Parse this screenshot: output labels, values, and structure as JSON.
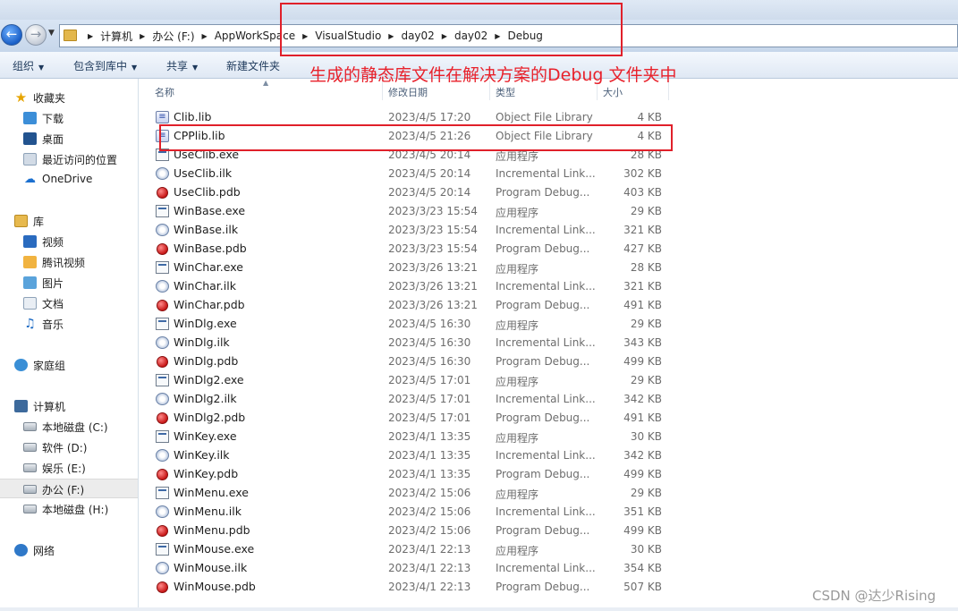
{
  "address_bar": {
    "crumbs": [
      "计算机",
      "办公 (F:)",
      "AppWorkSpace",
      "VisualStudio",
      "day02",
      "day02",
      "Debug"
    ]
  },
  "toolbar": {
    "organize": "组织",
    "include_in_library": "包含到库中",
    "share": "共享",
    "new_folder": "新建文件夹"
  },
  "annotation": "生成的静态库文件在解决方案的Debug 文件夹中",
  "sidebar": {
    "favorites": {
      "label": "收藏夹",
      "icon": "star-icon"
    },
    "favorites_items": [
      {
        "label": "下载",
        "icon": "downloads-icon"
      },
      {
        "label": "桌面",
        "icon": "desktop-icon"
      },
      {
        "label": "最近访问的位置",
        "icon": "recent-places-icon"
      },
      {
        "label": "OneDrive",
        "icon": "onedrive-icon"
      }
    ],
    "libraries": {
      "label": "库",
      "icon": "library-icon"
    },
    "libraries_items": [
      {
        "label": "视频",
        "icon": "videos-icon"
      },
      {
        "label": "腾讯视频",
        "icon": "tencent-video-icon"
      },
      {
        "label": "图片",
        "icon": "pictures-icon"
      },
      {
        "label": "文档",
        "icon": "documents-icon"
      },
      {
        "label": "音乐",
        "icon": "music-icon"
      }
    ],
    "homegroup": {
      "label": "家庭组",
      "icon": "homegroup-icon"
    },
    "computer": {
      "label": "计算机",
      "icon": "computer-icon"
    },
    "computer_items": [
      {
        "label": "本地磁盘 (C:)",
        "icon": "drive-icon",
        "selected": false
      },
      {
        "label": "软件 (D:)",
        "icon": "drive-icon",
        "selected": false
      },
      {
        "label": "娱乐 (E:)",
        "icon": "drive-icon",
        "selected": false
      },
      {
        "label": "办公 (F:)",
        "icon": "drive-icon",
        "selected": true
      },
      {
        "label": "本地磁盘 (H:)",
        "icon": "drive-icon",
        "selected": false
      }
    ],
    "network": {
      "label": "网络",
      "icon": "network-icon"
    }
  },
  "columns": {
    "name": "名称",
    "date_modified": "修改日期",
    "type": "类型",
    "size": "大小"
  },
  "files": [
    {
      "name": "Clib.lib",
      "date": "2023/4/5 17:20",
      "type": "Object File Library",
      "size": "4 KB",
      "kind": "lib"
    },
    {
      "name": "CPPlib.lib",
      "date": "2023/4/5 21:26",
      "type": "Object File Library",
      "size": "4 KB",
      "kind": "lib"
    },
    {
      "name": "UseClib.exe",
      "date": "2023/4/5 20:14",
      "type": "应用程序",
      "size": "28 KB",
      "kind": "exe"
    },
    {
      "name": "UseClib.ilk",
      "date": "2023/4/5 20:14",
      "type": "Incremental Link...",
      "size": "302 KB",
      "kind": "ilk"
    },
    {
      "name": "UseClib.pdb",
      "date": "2023/4/5 20:14",
      "type": "Program Debug...",
      "size": "403 KB",
      "kind": "pdb"
    },
    {
      "name": "WinBase.exe",
      "date": "2023/3/23 15:54",
      "type": "应用程序",
      "size": "29 KB",
      "kind": "exe"
    },
    {
      "name": "WinBase.ilk",
      "date": "2023/3/23 15:54",
      "type": "Incremental Link...",
      "size": "321 KB",
      "kind": "ilk"
    },
    {
      "name": "WinBase.pdb",
      "date": "2023/3/23 15:54",
      "type": "Program Debug...",
      "size": "427 KB",
      "kind": "pdb"
    },
    {
      "name": "WinChar.exe",
      "date": "2023/3/26 13:21",
      "type": "应用程序",
      "size": "28 KB",
      "kind": "exe"
    },
    {
      "name": "WinChar.ilk",
      "date": "2023/3/26 13:21",
      "type": "Incremental Link...",
      "size": "321 KB",
      "kind": "ilk"
    },
    {
      "name": "WinChar.pdb",
      "date": "2023/3/26 13:21",
      "type": "Program Debug...",
      "size": "491 KB",
      "kind": "pdb"
    },
    {
      "name": "WinDlg.exe",
      "date": "2023/4/5 16:30",
      "type": "应用程序",
      "size": "29 KB",
      "kind": "exe"
    },
    {
      "name": "WinDlg.ilk",
      "date": "2023/4/5 16:30",
      "type": "Incremental Link...",
      "size": "343 KB",
      "kind": "ilk"
    },
    {
      "name": "WinDlg.pdb",
      "date": "2023/4/5 16:30",
      "type": "Program Debug...",
      "size": "499 KB",
      "kind": "pdb"
    },
    {
      "name": "WinDlg2.exe",
      "date": "2023/4/5 17:01",
      "type": "应用程序",
      "size": "29 KB",
      "kind": "exe"
    },
    {
      "name": "WinDlg2.ilk",
      "date": "2023/4/5 17:01",
      "type": "Incremental Link...",
      "size": "342 KB",
      "kind": "ilk"
    },
    {
      "name": "WinDlg2.pdb",
      "date": "2023/4/5 17:01",
      "type": "Program Debug...",
      "size": "491 KB",
      "kind": "pdb"
    },
    {
      "name": "WinKey.exe",
      "date": "2023/4/1 13:35",
      "type": "应用程序",
      "size": "30 KB",
      "kind": "exe"
    },
    {
      "name": "WinKey.ilk",
      "date": "2023/4/1 13:35",
      "type": "Incremental Link...",
      "size": "342 KB",
      "kind": "ilk"
    },
    {
      "name": "WinKey.pdb",
      "date": "2023/4/1 13:35",
      "type": "Program Debug...",
      "size": "499 KB",
      "kind": "pdb"
    },
    {
      "name": "WinMenu.exe",
      "date": "2023/4/2 15:06",
      "type": "应用程序",
      "size": "29 KB",
      "kind": "exe"
    },
    {
      "name": "WinMenu.ilk",
      "date": "2023/4/2 15:06",
      "type": "Incremental Link...",
      "size": "351 KB",
      "kind": "ilk"
    },
    {
      "name": "WinMenu.pdb",
      "date": "2023/4/2 15:06",
      "type": "Program Debug...",
      "size": "499 KB",
      "kind": "pdb"
    },
    {
      "name": "WinMouse.exe",
      "date": "2023/4/1 22:13",
      "type": "应用程序",
      "size": "30 KB",
      "kind": "exe"
    },
    {
      "name": "WinMouse.ilk",
      "date": "2023/4/1 22:13",
      "type": "Incremental Link...",
      "size": "354 KB",
      "kind": "ilk"
    },
    {
      "name": "WinMouse.pdb",
      "date": "2023/4/1 22:13",
      "type": "Program Debug...",
      "size": "507 KB",
      "kind": "pdb"
    }
  ],
  "watermark": "CSDN @达少Rising",
  "colors": {
    "annotation_red": "#e8212b",
    "accent_blue": "#1e395b"
  }
}
